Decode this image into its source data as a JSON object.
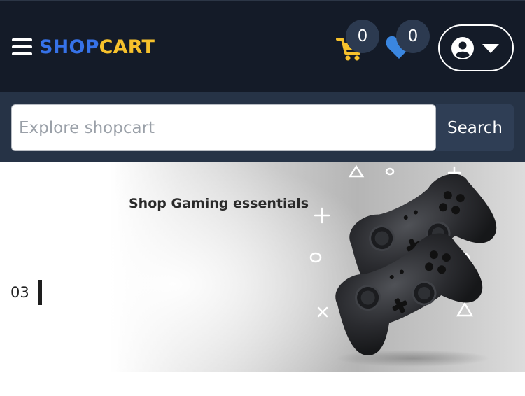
{
  "header": {
    "logo": {
      "part1": "SHOP",
      "part2": "CART"
    },
    "cart_count": "0",
    "wishlist_count": "0"
  },
  "search": {
    "placeholder": "Explore shopcart",
    "value": "",
    "button_label": "Search"
  },
  "hero": {
    "title": "Shop Gaming essentials",
    "slide_number": "03"
  },
  "colors": {
    "header_bg": "#141b28",
    "search_bar_bg": "#263346",
    "logo_blue": "#3672e8",
    "logo_yellow": "#f6c12c",
    "badge_bg": "#2c3a50",
    "wishlist_blue": "#3a86e0"
  },
  "icons": {
    "menu": "hamburger-menu-icon",
    "cart": "shopping-cart-icon",
    "wishlist": "heart-icon",
    "account": "user-circle-icon",
    "account_caret": "caret-down-icon"
  }
}
